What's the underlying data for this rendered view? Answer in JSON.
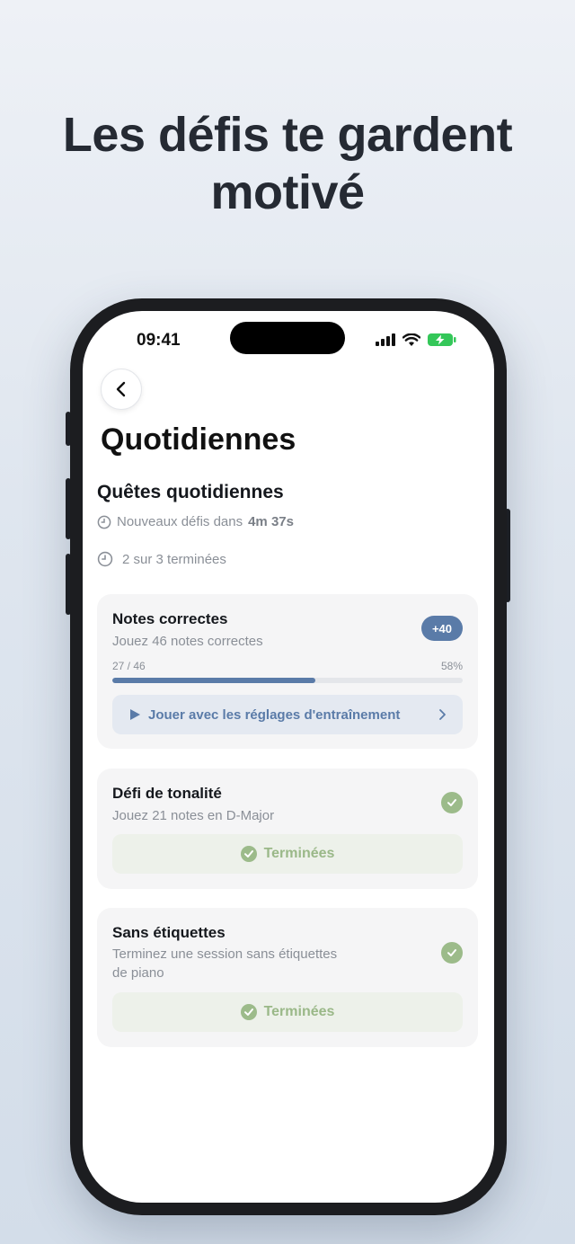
{
  "headline": {
    "line1": "Les défis te gardent",
    "line2": "motivé"
  },
  "status_bar": {
    "time": "09:41"
  },
  "colors": {
    "accent": "#5a7ba8",
    "success": "#9cbb8a",
    "battery": "#34c759"
  },
  "page": {
    "title": "Quotidiennes"
  },
  "section": {
    "title": "Quêtes quotidiennes",
    "refresh_prefix": "Nouveaux défis dans",
    "refresh_time": "4m 37s",
    "completed": "2 sur 3 terminées"
  },
  "quests": [
    {
      "title": "Notes correctes",
      "description": "Jouez 46 notes correctes",
      "reward": "+40",
      "progress_text": "27 / 46",
      "progress_percent": "58%",
      "progress_value": 0.58,
      "action_label": "Jouer avec les réglages d'entraînement"
    },
    {
      "title": "Défi de tonalité",
      "description": "Jouez 21 notes en D-Major",
      "status": "Terminées"
    },
    {
      "title": "Sans étiquettes",
      "description": "Terminez une session sans étiquettes",
      "description2": "de piano",
      "status": "Terminées"
    }
  ]
}
